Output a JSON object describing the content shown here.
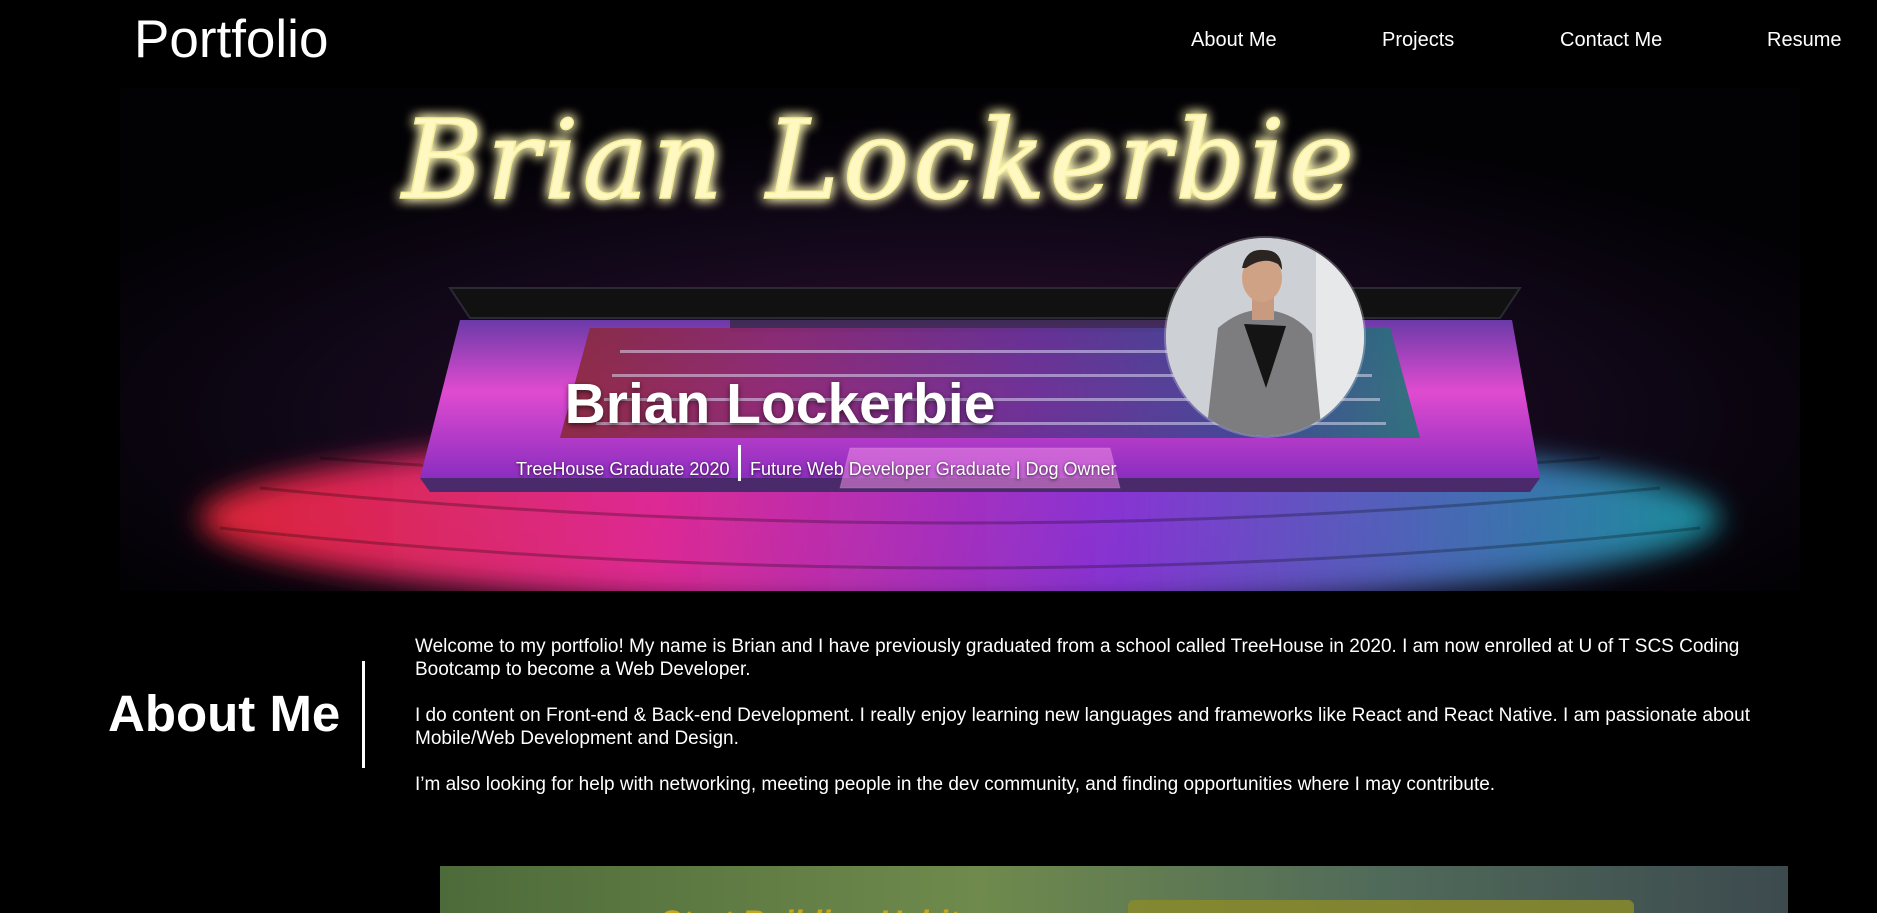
{
  "header": {
    "brand": "Portfolio",
    "nav": [
      {
        "label": "About Me"
      },
      {
        "label": "Projects"
      },
      {
        "label": "Contact Me"
      },
      {
        "label": "Resume"
      }
    ]
  },
  "hero": {
    "signature": "Brian Lockerbie",
    "name": "Brian Lockerbie",
    "tagline_left": "TreeHouse Graduate 2020",
    "tagline_right": "Future Web Developer Graduate | Dog Owner",
    "avatar_icon": "profile-photo"
  },
  "about": {
    "heading": "About Me",
    "paragraphs": [
      "Welcome to my portfolio! My name is Brian and I have previously graduated from a school called TreeHouse in 2020. I am now enrolled at U of T SCS Coding Bootcamp to become a Web Developer.",
      "I do content on Front-end & Back-end Development. I really enjoy learning new languages and frameworks like React and React Native. I am passionate about Mobile/Web Development and Design.",
      "I’m also looking for help with networking, meeting people in the dev community, and finding opportunities where I may contribute."
    ]
  },
  "project_preview": {
    "title": "Start Building Habits"
  },
  "colors": {
    "background": "#000000",
    "text": "#ffffff",
    "neon_sign": "#f6f09a",
    "project_accent": "#c9a51c"
  }
}
